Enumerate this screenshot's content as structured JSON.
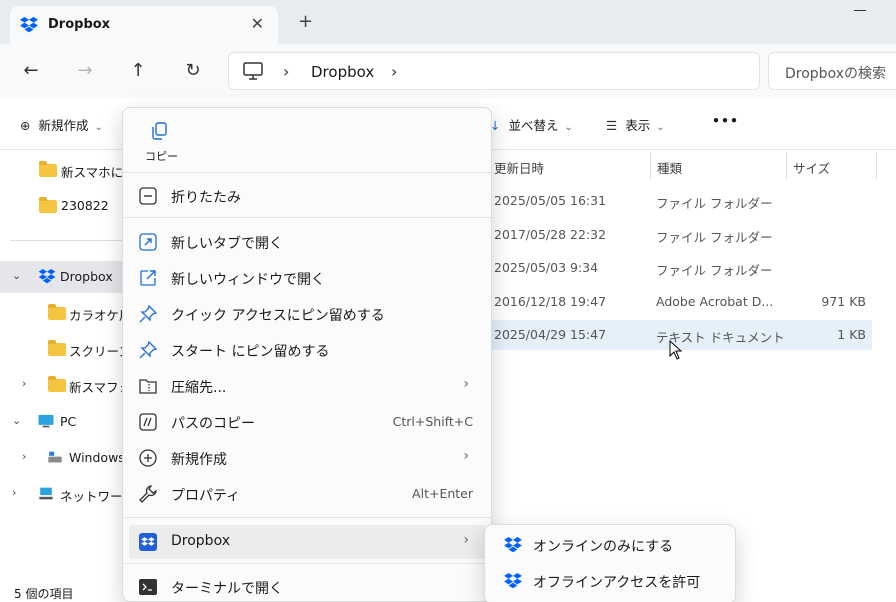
{
  "tab": {
    "title": "Dropbox",
    "close": "✕",
    "new": "+"
  },
  "nav": {
    "back": "←",
    "forward": "→",
    "up": "↑",
    "refresh": "↻"
  },
  "address": {
    "sep1": "›",
    "location": "Dropbox",
    "sep2": "›"
  },
  "search": {
    "placeholder": "Dropboxの検索"
  },
  "commandbar": {
    "new_label": "新規作成",
    "sort_label": "並べ替え",
    "view_label": "表示",
    "more": "•••"
  },
  "sidebar": {
    "items": [
      {
        "label": "新スマホに送"
      },
      {
        "label": "230822"
      },
      {
        "label": "Dropbox"
      },
      {
        "label": "カラオケ用"
      },
      {
        "label": "スクリーンシ"
      },
      {
        "label": "新スマフォ"
      },
      {
        "label": "PC"
      },
      {
        "label": "Windows"
      },
      {
        "label": "ネットワーク"
      }
    ],
    "status": "5 個の項目"
  },
  "filelist": {
    "headers": {
      "modified": "更新日時",
      "type": "種類",
      "size": "サイズ"
    },
    "rows": [
      {
        "modified": "2025/05/05 16:31",
        "type": "ファイル フォルダー",
        "size": ""
      },
      {
        "modified": "2017/05/28 22:32",
        "type": "ファイル フォルダー",
        "size": ""
      },
      {
        "modified": "2025/05/03 9:34",
        "type": "ファイル フォルダー",
        "size": ""
      },
      {
        "modified": "2016/12/18 19:47",
        "type": "Adobe Acrobat D...",
        "size": "971 KB"
      },
      {
        "modified": "2025/04/29 15:47",
        "type": "テキスト ドキュメント",
        "size": "1 KB"
      }
    ]
  },
  "context_menu": {
    "copy_label": "コピー",
    "items": [
      {
        "label": "折りたたみ",
        "shortcut": ""
      },
      {
        "label": "新しいタブで開く",
        "shortcut": ""
      },
      {
        "label": "新しいウィンドウで開く",
        "shortcut": ""
      },
      {
        "label": "クイック アクセスにピン留めする",
        "shortcut": ""
      },
      {
        "label": "スタート にピン留めする",
        "shortcut": ""
      },
      {
        "label": "圧縮先...",
        "shortcut": ""
      },
      {
        "label": "パスのコピー",
        "shortcut": "Ctrl+Shift+C"
      },
      {
        "label": "新規作成",
        "shortcut": ""
      },
      {
        "label": "プロパティ",
        "shortcut": "Alt+Enter"
      },
      {
        "label": "Dropbox",
        "shortcut": ""
      },
      {
        "label": "ターミナルで開く",
        "shortcut": ""
      }
    ],
    "arrow": "›"
  },
  "submenu": {
    "items": [
      {
        "label": "オンラインのみにする"
      },
      {
        "label": "オフラインアクセスを許可"
      }
    ]
  },
  "colors": {
    "dropbox_blue": "#0061fe",
    "folder_yellow": "#f5c542",
    "selection": "#e5f0fb"
  },
  "icons": [
    "dropbox-icon",
    "pc-icon",
    "folder-icon",
    "copy-icon",
    "pin-icon",
    "terminal-icon"
  ]
}
